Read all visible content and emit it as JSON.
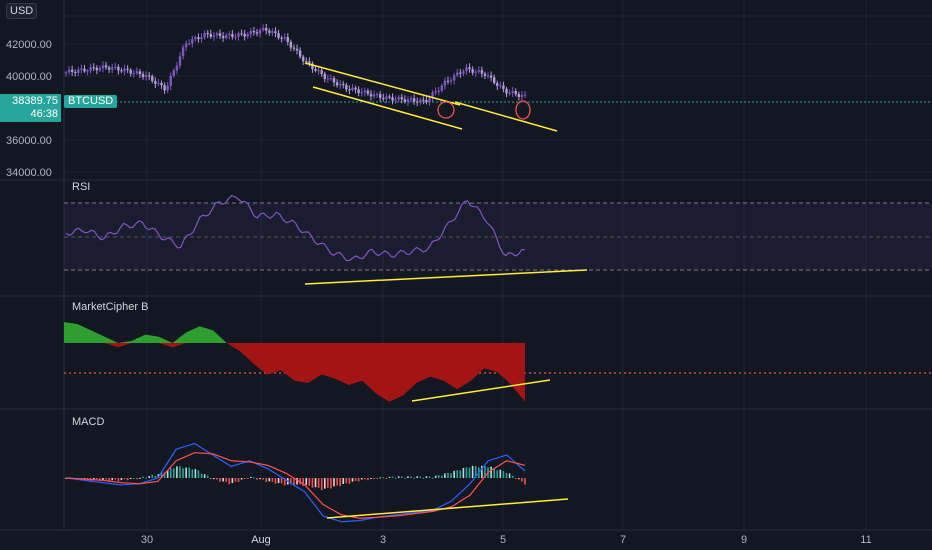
{
  "price_axis": {
    "currency_badge": "USD",
    "ticks": [
      "42000.00",
      "40000.00",
      "36000.00",
      "34000.00"
    ],
    "last_price": "38389.75",
    "countdown": "46:38",
    "symbol": "BTCUSD"
  },
  "time_axis": {
    "ticks": [
      "30",
      "Aug",
      "3",
      "5",
      "7",
      "9",
      "11"
    ]
  },
  "panes": {
    "rsi": "RSI",
    "mcb": "MarketCipher B",
    "macd": "MACD"
  },
  "colors": {
    "background": "#131722",
    "up": "#26a69a",
    "down": "#ef5350",
    "candle": "#7e57c2",
    "trendline": "#ffeb3b",
    "rsi_line": "#7e57c2",
    "mcb_green": "#2e9e2e",
    "mcb_red": "#a31515",
    "macd_line": "#2962ff",
    "signal_line": "#ff5252"
  },
  "chart_data": [
    {
      "type": "line",
      "title": "BTCUSD",
      "x": [
        "Jul 29",
        "Jul 29",
        "Jul 29",
        "Jul 30",
        "Jul 30",
        "Jul 30",
        "Jul 31",
        "Jul 31",
        "Jul 31",
        "Aug 1",
        "Aug 1",
        "Aug 1",
        "Aug 2",
        "Aug 2",
        "Aug 2",
        "Aug 3",
        "Aug 3",
        "Aug 3",
        "Aug 4",
        "Aug 4",
        "Aug 4",
        "Aug 5",
        "Aug 5",
        "Aug 5"
      ],
      "values": [
        39800,
        39950,
        40100,
        39900,
        39600,
        38800,
        41500,
        42000,
        41900,
        42000,
        42300,
        41700,
        40400,
        39500,
        38900,
        38600,
        38300,
        38200,
        38100,
        39200,
        40000,
        39700,
        38700,
        38390
      ],
      "ylim": [
        34000,
        44000
      ],
      "annotations": [
        "descending channel (two trendlines)",
        "two circled wicks"
      ]
    },
    {
      "type": "line",
      "title": "RSI",
      "values": [
        52,
        54,
        49,
        56,
        58,
        50,
        44,
        60,
        70,
        74,
        62,
        63,
        57,
        48,
        40,
        36,
        41,
        39,
        41,
        43,
        57,
        72,
        60,
        38,
        42
      ],
      "ylim": [
        25,
        80
      ],
      "bands": [
        70,
        50,
        30
      ]
    },
    {
      "type": "area",
      "title": "MarketCipher B",
      "values": [
        10,
        9,
        6,
        3,
        -2,
        1,
        4,
        3,
        -2,
        5,
        8,
        6,
        0,
        -4,
        -10,
        -15,
        -13,
        -18,
        -19,
        -15,
        -17,
        -20,
        -18,
        -24,
        -28,
        -25,
        -19,
        -16,
        -18,
        -22,
        -18,
        -12,
        -14,
        -20,
        -28
      ],
      "ylim": [
        -40,
        20
      ]
    },
    {
      "type": "line",
      "title": "MACD",
      "series": [
        {
          "values": [
            0,
            -20,
            -40,
            -60,
            -50,
            0,
            250,
            300,
            200,
            100,
            150,
            80,
            -20,
            -120,
            -330,
            -380,
            -370,
            -340,
            -320,
            -300,
            -280,
            -200,
            -50,
            150,
            200,
            60
          ]
        },
        {
          "values": [
            0,
            -10,
            -20,
            -40,
            -50,
            -30,
            150,
            220,
            210,
            150,
            140,
            110,
            40,
            -60,
            -230,
            -320,
            -350,
            -340,
            -330,
            -310,
            -290,
            -250,
            -150,
            50,
            150,
            110
          ]
        }
      ],
      "ylim": [
        -450,
        350
      ]
    }
  ]
}
